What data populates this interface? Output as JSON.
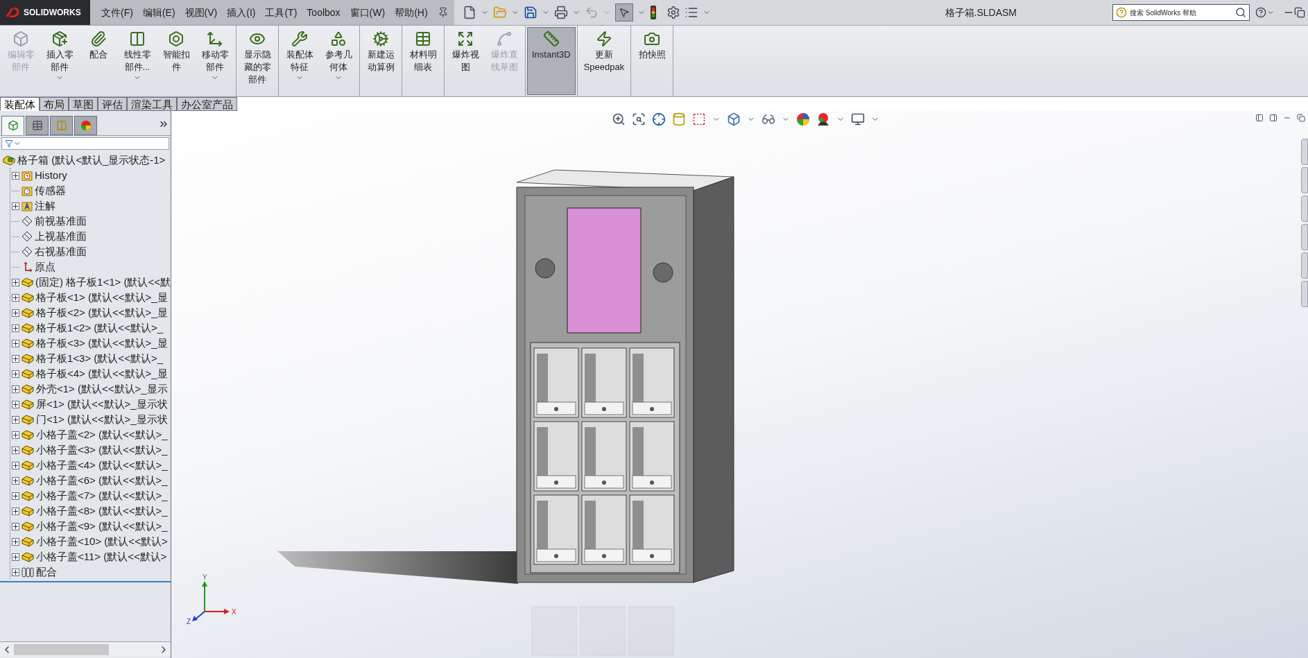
{
  "logo": "SOLIDWORKS",
  "menu": [
    "文件(F)",
    "编辑(E)",
    "视图(V)",
    "插入(I)",
    "工具(T)",
    "Toolbox",
    "窗口(W)",
    "帮助(H)"
  ],
  "title": "格子箱.SLDASM",
  "search": {
    "placeholder": "搜索 SolidWorks 帮助"
  },
  "ribbon": [
    [
      {
        "label": "编辑零部件",
        "disabled": true,
        "dropdown": false,
        "selected": false
      },
      {
        "label": "插入零部件",
        "disabled": false,
        "dropdown": true,
        "selected": false
      },
      {
        "label": "配合",
        "disabled": false,
        "dropdown": false,
        "selected": false
      },
      {
        "label": "线性零部件...",
        "disabled": false,
        "dropdown": true,
        "selected": false
      },
      {
        "label": "智能扣件",
        "disabled": false,
        "dropdown": false,
        "selected": false
      },
      {
        "label": "移动零部件",
        "disabled": false,
        "dropdown": true,
        "selected": false
      }
    ],
    [
      {
        "label": "显示隐藏的零部件",
        "disabled": false,
        "dropdown": false,
        "selected": false
      }
    ],
    [
      {
        "label": "装配体特征",
        "disabled": false,
        "dropdown": true,
        "selected": false
      },
      {
        "label": "参考几何体",
        "disabled": false,
        "dropdown": true,
        "selected": false
      }
    ],
    [
      {
        "label": "新建运动算例",
        "disabled": false,
        "dropdown": false,
        "selected": false
      }
    ],
    [
      {
        "label": "材料明细表",
        "disabled": false,
        "dropdown": false,
        "selected": false
      }
    ],
    [
      {
        "label": "爆炸视图",
        "disabled": false,
        "dropdown": false,
        "selected": false
      },
      {
        "label": "爆炸直线草图",
        "disabled": true,
        "dropdown": false,
        "selected": false
      }
    ],
    [
      {
        "label": "Instant3D",
        "disabled": false,
        "dropdown": false,
        "selected": true
      }
    ],
    [
      {
        "label": "更新 Speedpak",
        "disabled": false,
        "dropdown": false,
        "selected": false
      }
    ],
    [
      {
        "label": "拍快照",
        "disabled": false,
        "dropdown": false,
        "selected": false
      }
    ]
  ],
  "tabs": [
    {
      "label": "装配体",
      "selected": true
    },
    {
      "label": "布局",
      "selected": false
    },
    {
      "label": "草图",
      "selected": false
    },
    {
      "label": "评估",
      "selected": false
    },
    {
      "label": "渲染工具",
      "selected": false
    },
    {
      "label": "办公室产品",
      "selected": false
    }
  ],
  "panel_tabs": [
    {
      "selected": true
    },
    {
      "selected": false
    },
    {
      "selected": false
    },
    {
      "selected": false
    }
  ],
  "tree": {
    "label": "格子箱  (默认<默认_显示状态-1>",
    "children": [
      {
        "label": "History",
        "kind": "history",
        "expandable": true
      },
      {
        "label": "传感器",
        "kind": "sensors",
        "expandable": false
      },
      {
        "label": "注解",
        "kind": "annotations",
        "expandable": true
      },
      {
        "label": "前视基准面",
        "kind": "plane",
        "expandable": false
      },
      {
        "label": "上视基准面",
        "kind": "plane",
        "expandable": false
      },
      {
        "label": "右视基准面",
        "kind": "plane",
        "expandable": false
      },
      {
        "label": "原点",
        "kind": "origin",
        "expandable": false
      },
      {
        "label": "(固定) 格子板1<1> (默认<<默",
        "kind": "part",
        "expandable": true
      },
      {
        "label": "格子板<1> (默认<<默认>_显",
        "kind": "part",
        "expandable": true
      },
      {
        "label": "格子板<2> (默认<<默认>_显",
        "kind": "part",
        "expandable": true
      },
      {
        "label": "格子板1<2> (默认<<默认>_",
        "kind": "part",
        "expandable": true
      },
      {
        "label": "格子板<3> (默认<<默认>_显",
        "kind": "part",
        "expandable": true
      },
      {
        "label": "格子板1<3> (默认<<默认>_",
        "kind": "part",
        "expandable": true
      },
      {
        "label": "格子板<4> (默认<<默认>_显",
        "kind": "part",
        "expandable": true
      },
      {
        "label": "外壳<1> (默认<<默认>_显示",
        "kind": "part",
        "expandable": true
      },
      {
        "label": "屏<1> (默认<<默认>_显示状",
        "kind": "part",
        "expandable": true
      },
      {
        "label": "门<1> (默认<<默认>_显示状",
        "kind": "part",
        "expandable": true
      },
      {
        "label": "小格子盖<2> (默认<<默认>_",
        "kind": "part",
        "expandable": true
      },
      {
        "label": "小格子盖<3> (默认<<默认>_",
        "kind": "part",
        "expandable": true
      },
      {
        "label": "小格子盖<4> (默认<<默认>_",
        "kind": "part",
        "expandable": true
      },
      {
        "label": "小格子盖<6> (默认<<默认>_",
        "kind": "part",
        "expandable": true
      },
      {
        "label": "小格子盖<7> (默认<<默认>_",
        "kind": "part",
        "expandable": true
      },
      {
        "label": "小格子盖<8> (默认<<默认>_",
        "kind": "part",
        "expandable": true
      },
      {
        "label": "小格子盖<9> (默认<<默认>_",
        "kind": "part",
        "expandable": true
      },
      {
        "label": "小格子盖<10> (默认<<默认>",
        "kind": "part",
        "expandable": true
      },
      {
        "label": "小格子盖<11> (默认<<默认>",
        "kind": "part",
        "expandable": true
      },
      {
        "label": "配合",
        "kind": "mates",
        "expandable": true
      }
    ]
  },
  "triad": {
    "y": "Y",
    "x": "X",
    "z": "Z"
  }
}
